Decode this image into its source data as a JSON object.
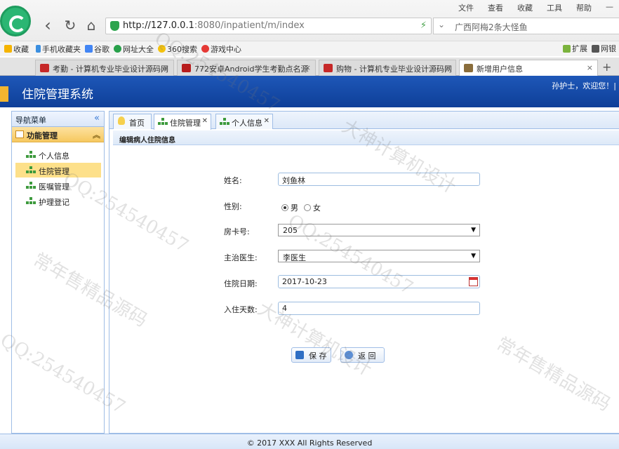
{
  "browser": {
    "url_host": "http://127.0.0.1",
    "url_rest": ":8080/inpatient/m/index",
    "search_text": "广西阿梅2条大怪鱼",
    "top_menu": [
      "文件",
      "查看",
      "收藏",
      "工具",
      "帮助"
    ],
    "bookmarks": [
      "收藏",
      "手机收藏夹",
      "谷歌",
      "网址大全",
      "360搜索",
      "游戏中心"
    ],
    "bookmarks_right": [
      "扩展",
      "网银"
    ],
    "tabs": [
      {
        "label": "考勤 - 计算机专业毕业设计源码网"
      },
      {
        "label": "772安卓Android学生考勤点名源"
      },
      {
        "label": "购物 - 计算机专业毕业设计源码网"
      },
      {
        "label": "新增用户信息",
        "active": true
      }
    ]
  },
  "app": {
    "title": "住院管理系统",
    "welcome": "孙护士，欢迎您！|"
  },
  "sidebar": {
    "header": "导航菜单",
    "group": "功能管理",
    "items": [
      {
        "label": "个人信息"
      },
      {
        "label": "住院管理",
        "active": true
      },
      {
        "label": "医嘱管理"
      },
      {
        "label": "护理登记"
      }
    ]
  },
  "main": {
    "tabs": [
      {
        "label": "首页"
      },
      {
        "label": "住院管理",
        "active": true
      },
      {
        "label": "个人信息"
      }
    ],
    "form_title": "编辑病人住院信息",
    "fields": {
      "name_label": "姓名:",
      "name_value": "刘鱼林",
      "gender_label": "性别:",
      "gender_male": "男",
      "gender_female": "女",
      "gender_selected": "男",
      "room_label": "房卡号:",
      "room_value": "205",
      "doctor_label": "主治医生:",
      "doctor_value": "李医生",
      "date_label": "住院日期:",
      "date_value": "2017-10-23",
      "days_label": "入住天数:",
      "days_value": "4"
    },
    "buttons": {
      "save": "保 存",
      "back": "返 回"
    }
  },
  "footer": {
    "copyright": "© 2017 XXX All Rights Reserved"
  },
  "watermarks": [
    "大神计算机设计",
    "QQ:254540457",
    "常年售精品源码"
  ],
  "colors": {
    "header_blue": "#1549a8",
    "active_item": "#fde08a",
    "panel_border": "#9fbde6"
  }
}
